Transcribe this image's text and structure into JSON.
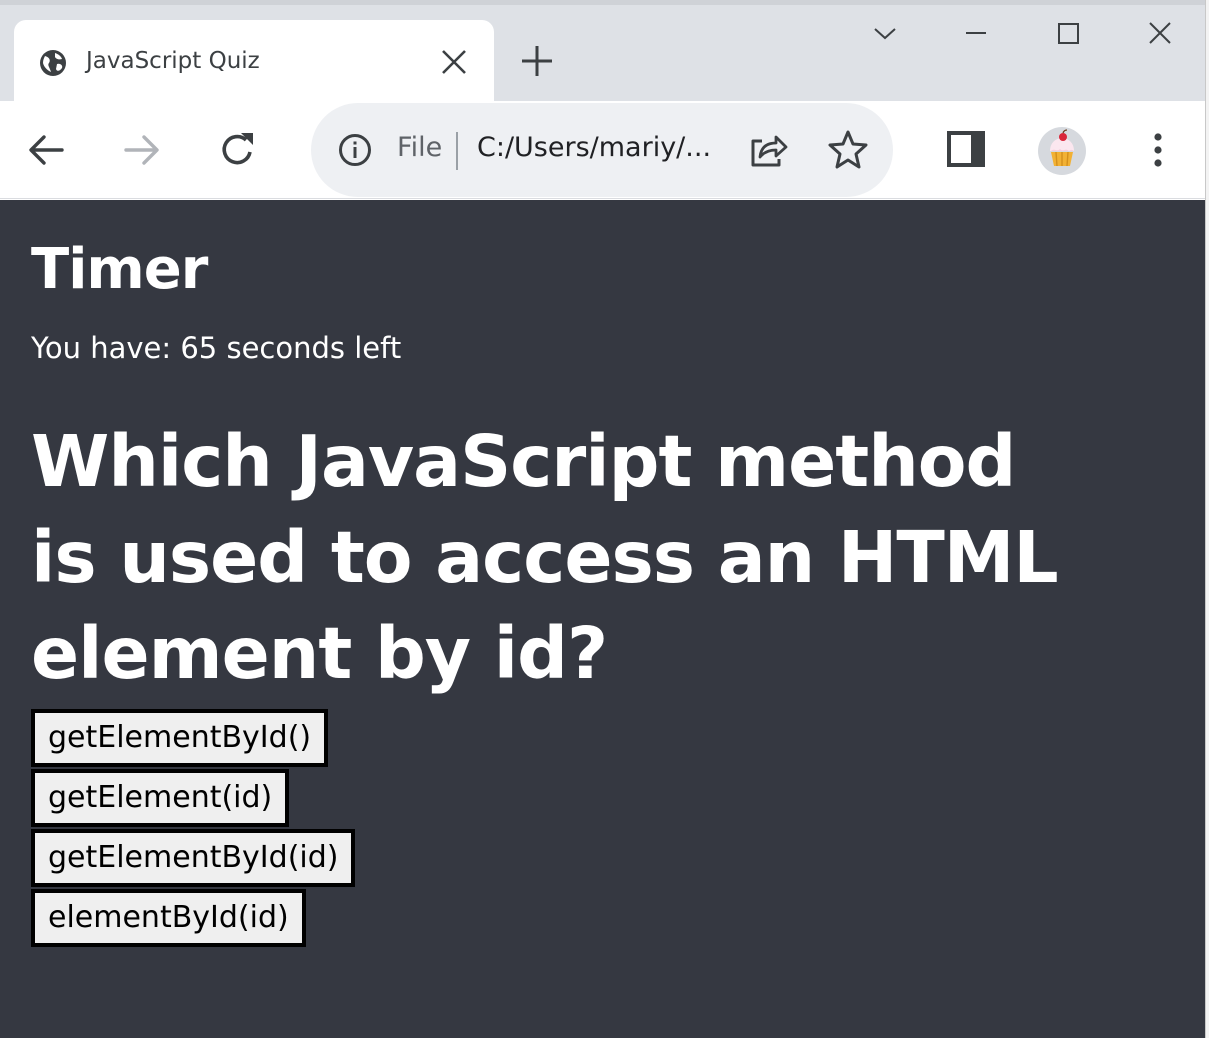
{
  "browser": {
    "tab": {
      "title": "JavaScript Quiz",
      "favicon": "globe-icon"
    },
    "address_bar": {
      "scheme_label": "File",
      "url": "C:/Users/mariy/..."
    },
    "colors": {
      "tabstrip": "#dee1e6",
      "omnibox": "#eef0f3"
    }
  },
  "page": {
    "background": "#353841",
    "timer": {
      "title": "Timer",
      "text": "You have: 65 seconds left"
    },
    "question": "Which JavaScript method is used to access an HTML element by id?",
    "answers": [
      "getElementById()",
      "getElement(id)",
      "getElementById(id)",
      "elementById(id)"
    ]
  }
}
